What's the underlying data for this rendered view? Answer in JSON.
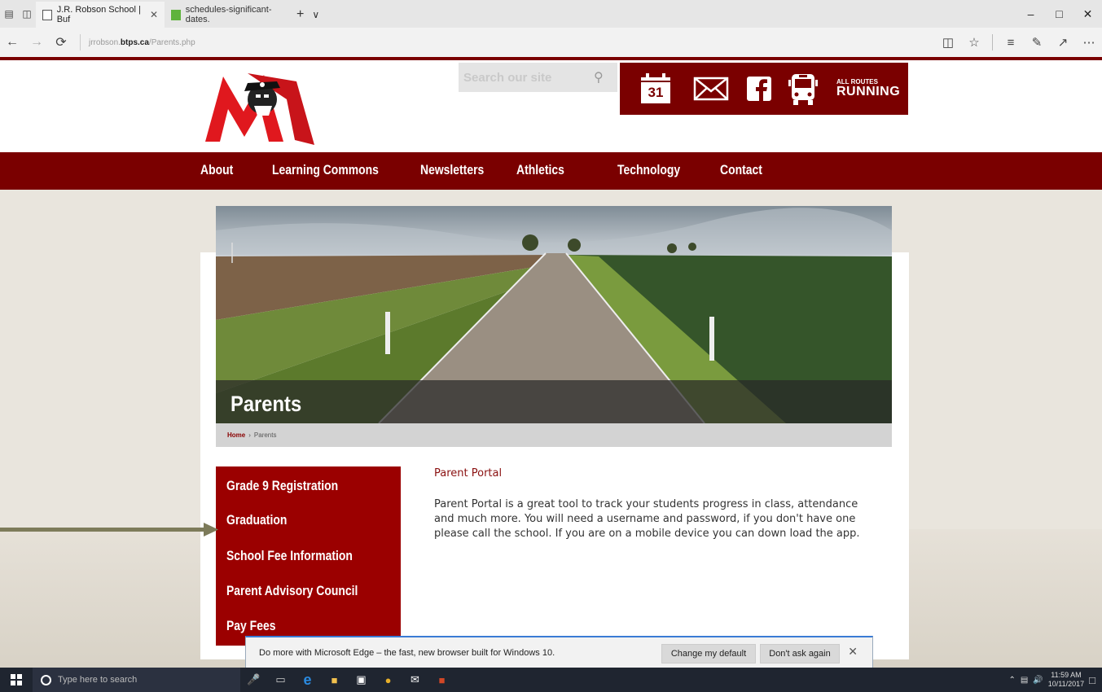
{
  "browser": {
    "tabs": [
      {
        "title": "J.R. Robson School | Buf",
        "active": true
      },
      {
        "title": "schedules-significant-dates.",
        "active": false
      }
    ],
    "new_tab": "+",
    "tab_list": "∨",
    "url_prefix": "jrrobson.",
    "url_domain": "btps.ca",
    "url_path": "/Parents.php",
    "window": {
      "minimize": "–",
      "maximize": "□",
      "close": "✕"
    }
  },
  "site": {
    "search_placeholder": "Search our site",
    "calendar_day": "31",
    "routes_line1": "ALL ROUTES",
    "routes_line2": "RUNNING",
    "nav": [
      "About",
      "Learning Commons",
      "Newsletters",
      "Athletics",
      "Technology",
      "Contact"
    ],
    "page_title": "Parents",
    "breadcrumb": {
      "home": "Home",
      "sep": "›",
      "current": "Parents"
    },
    "side_menu": [
      "Grade 9 Registration",
      "Graduation",
      "School Fee Information",
      "Parent Advisory Council",
      "Pay Fees"
    ],
    "content": {
      "heading": "Parent Portal",
      "body": "Parent Portal is a great tool to track your students progress in class, attendance and much more. You will need a username and password, if you don't have one please call the school. If you are on a mobile device you can down load the app."
    }
  },
  "notification": {
    "message": "Do more with Microsoft Edge – the fast, new browser built for Windows 10.",
    "change_default": "Change my default",
    "dont_ask": "Don't ask again"
  },
  "taskbar": {
    "search_placeholder": "Type here to search",
    "time": "11:59 AM",
    "date": "10/11/2017"
  },
  "colors": {
    "brand": "#7a0000",
    "side_menu": "#9b0000",
    "arrow": "#7d7b5a"
  }
}
